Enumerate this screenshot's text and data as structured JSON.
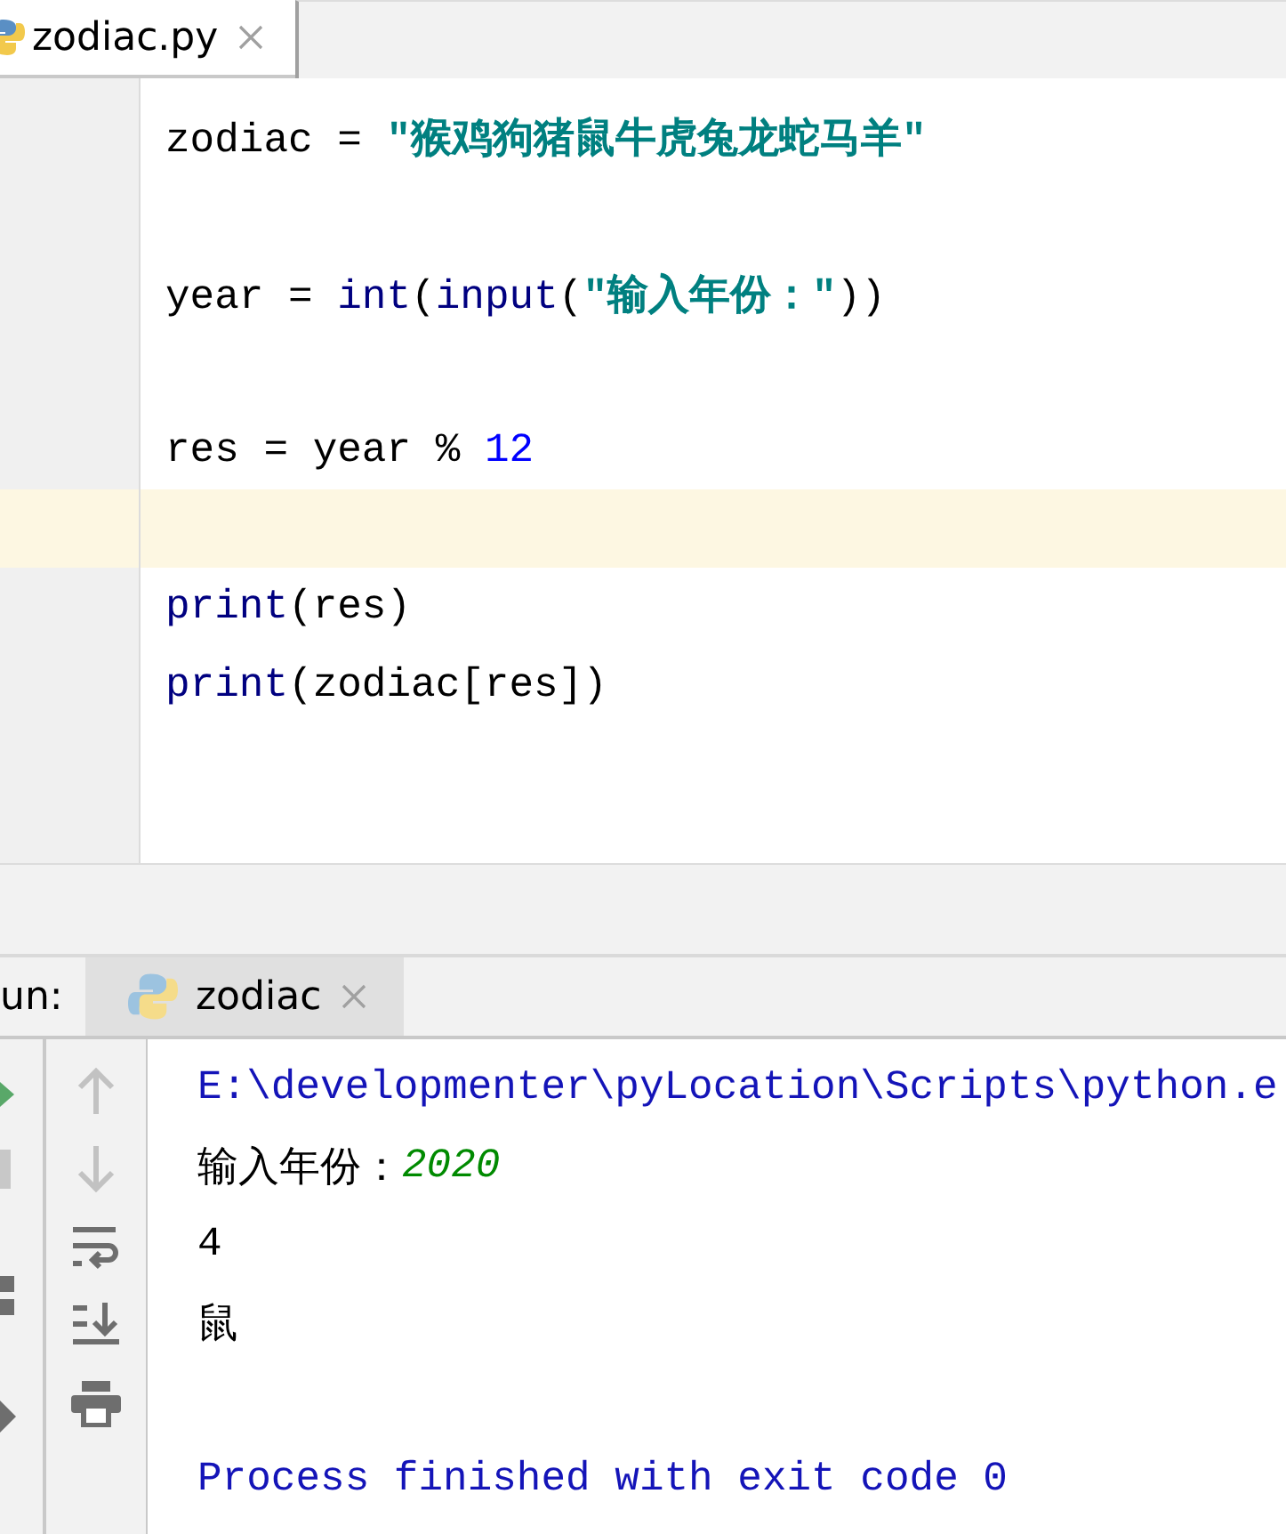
{
  "editor_tab": {
    "filename": "zodiac.py",
    "selected": true
  },
  "code_lines": [
    {
      "current": false,
      "tokens": [
        {
          "kind": "plain",
          "text": "zodiac = "
        },
        {
          "kind": "string",
          "text": "\"猴鸡狗猪鼠牛虎兔龙蛇马羊\""
        }
      ]
    },
    {
      "current": false
    },
    {
      "current": false,
      "tokens": [
        {
          "kind": "plain",
          "text": "year = "
        },
        {
          "kind": "builtin",
          "text": "int"
        },
        {
          "kind": "plain",
          "text": "("
        },
        {
          "kind": "builtin",
          "text": "input"
        },
        {
          "kind": "plain",
          "text": "("
        },
        {
          "kind": "string",
          "text": "\"输入年份：\""
        },
        {
          "kind": "plain",
          "text": "))"
        }
      ]
    },
    {
      "current": false
    },
    {
      "current": false,
      "tokens": [
        {
          "kind": "plain",
          "text": "res = year % "
        },
        {
          "kind": "number",
          "text": "12"
        }
      ]
    },
    {
      "current": true
    },
    {
      "current": false,
      "tokens": [
        {
          "kind": "builtin",
          "text": "print"
        },
        {
          "kind": "plain",
          "text": "(res)"
        }
      ]
    },
    {
      "current": false,
      "tokens": [
        {
          "kind": "builtin",
          "text": "print"
        },
        {
          "kind": "plain",
          "text": "(zodiac[res])"
        }
      ]
    }
  ],
  "run_panel": {
    "label": "un:",
    "tab": {
      "label": "zodiac",
      "selected": true
    },
    "console_lines": [
      {
        "kind": "output",
        "tokens": [
          {
            "kind": "system",
            "text": "E:\\developmenter\\pyLocation\\Scripts\\python.e"
          }
        ]
      },
      {
        "kind": "output",
        "tokens": [
          {
            "kind": "stdout",
            "text": "输入年份："
          },
          {
            "kind": "input",
            "text": "2020"
          }
        ]
      },
      {
        "kind": "output",
        "tokens": [
          {
            "kind": "stdout",
            "text": "4"
          }
        ]
      },
      {
        "kind": "output",
        "tokens": [
          {
            "kind": "stdout",
            "text": "鼠"
          }
        ]
      },
      {
        "kind": "blank"
      },
      {
        "kind": "output",
        "tokens": [
          {
            "kind": "system",
            "text": "Process finished with exit code 0"
          }
        ]
      }
    ]
  }
}
